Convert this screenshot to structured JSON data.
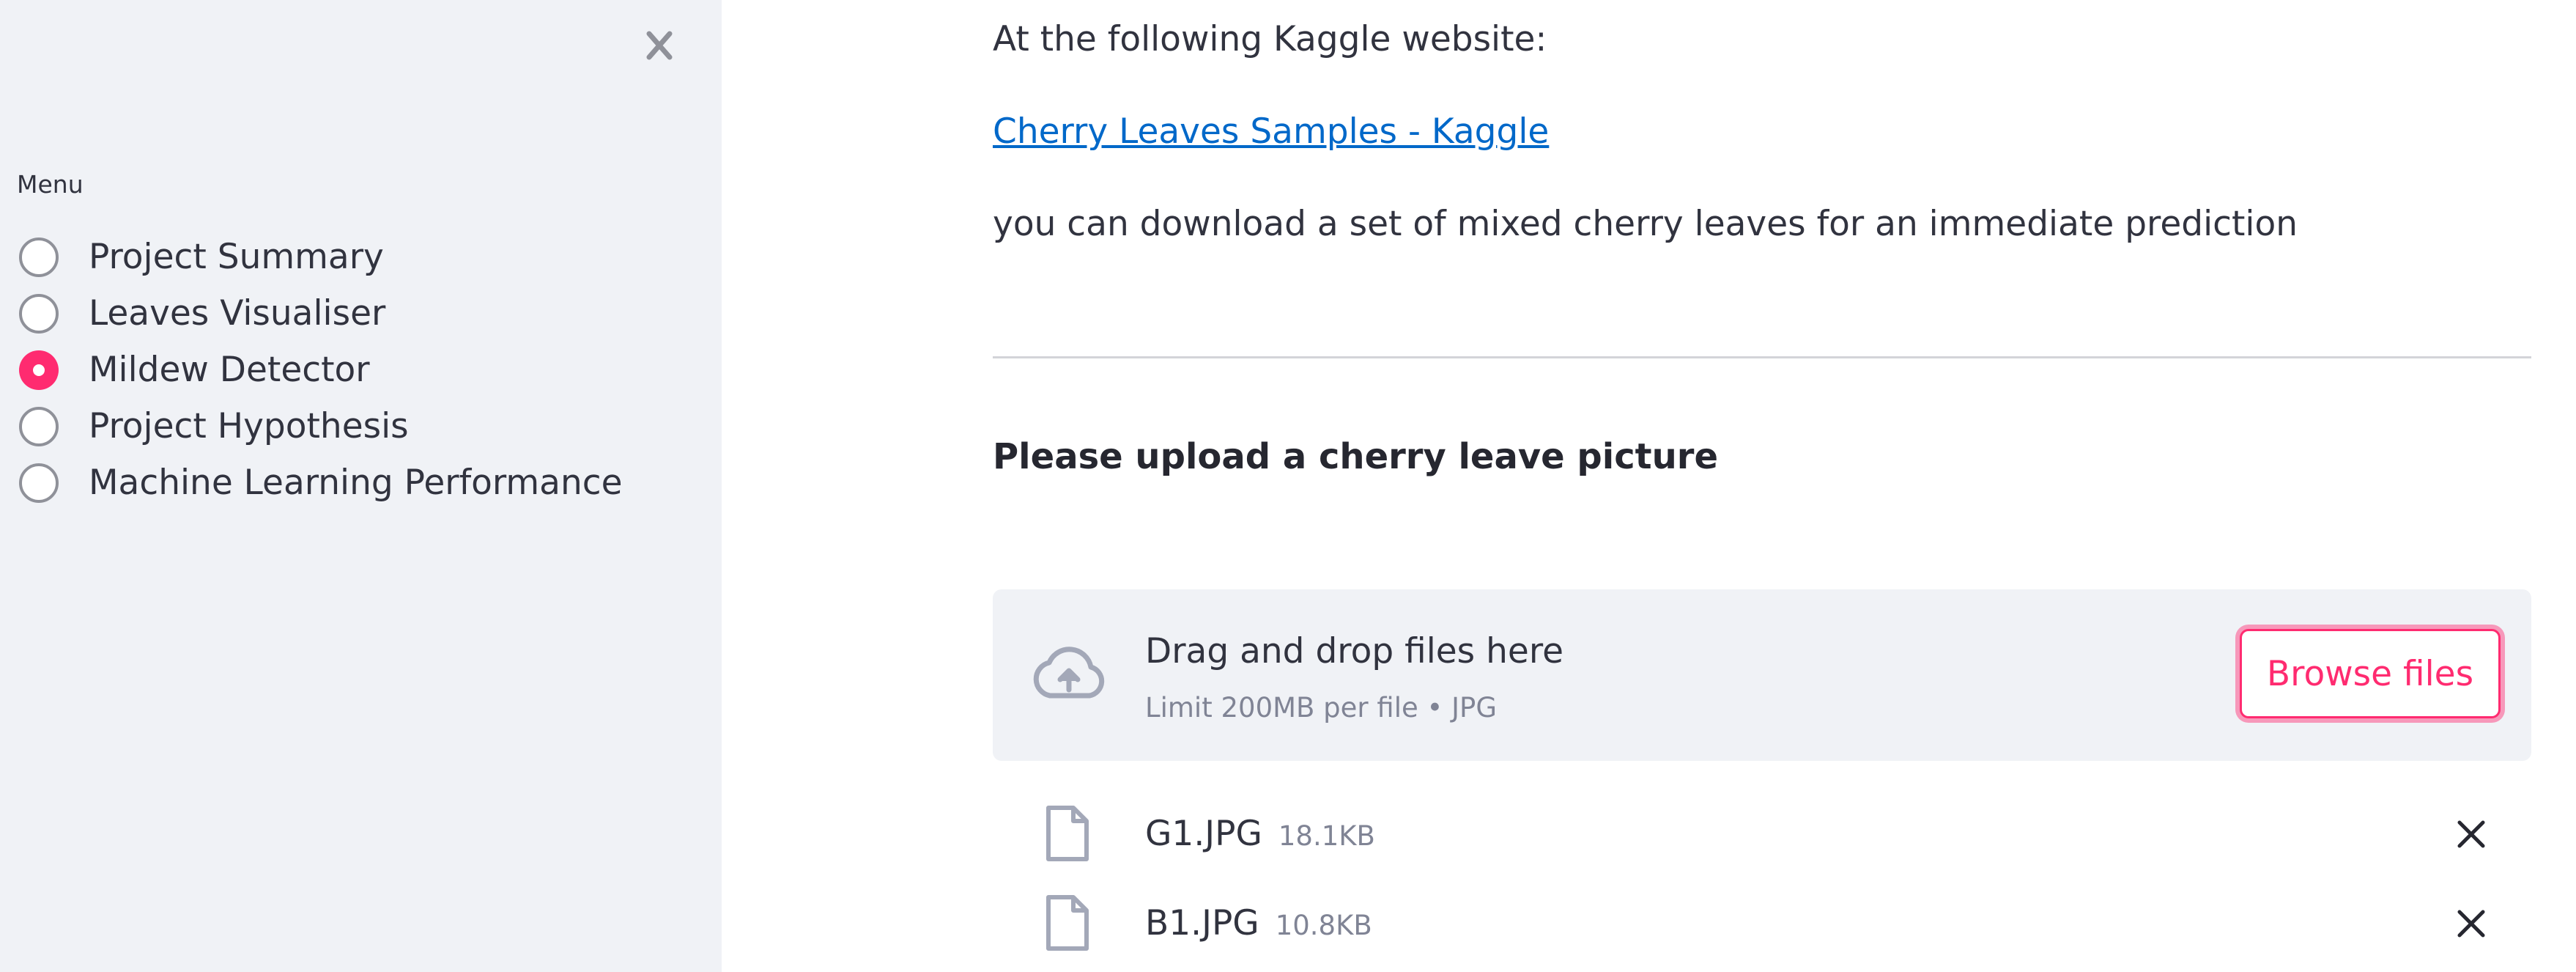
{
  "sidebar": {
    "menu_label": "Menu",
    "items": [
      {
        "label": "Project Summary",
        "selected": false
      },
      {
        "label": "Leaves Visualiser",
        "selected": false
      },
      {
        "label": "Mildew Detector",
        "selected": true
      },
      {
        "label": "Project Hypothesis",
        "selected": false
      },
      {
        "label": "Machine Learning Performance",
        "selected": false
      }
    ]
  },
  "main": {
    "intro_text": "At the following Kaggle website:",
    "link_text": "Cherry Leaves Samples - Kaggle",
    "download_text": "you can download a set of mixed cherry leaves for an immediate prediction",
    "upload_heading": "Please upload a cherry leave picture",
    "uploader": {
      "drop_title": "Drag and drop files here",
      "limit_text": "Limit 200MB per file • JPG",
      "browse_label": "Browse files"
    },
    "files": [
      {
        "name": "G1.JPG",
        "size": "18.1KB"
      },
      {
        "name": "B1.JPG",
        "size": "10.8KB"
      }
    ]
  },
  "colors": {
    "accent": "#ff2b70",
    "link": "#0068c9",
    "sidebar_bg": "#f0f2f6",
    "muted_text": "#808495"
  },
  "icons": {
    "sidebar_close": "close-icon",
    "upload": "cloud-upload-icon",
    "file": "file-icon",
    "remove": "close-icon"
  }
}
